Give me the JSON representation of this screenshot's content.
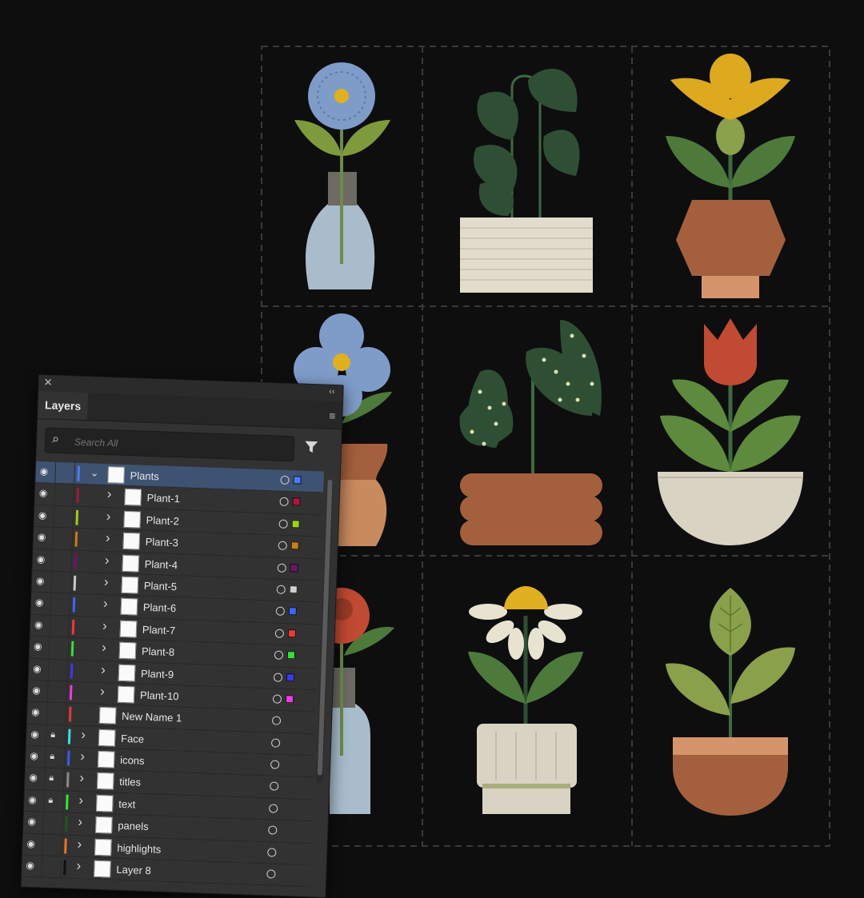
{
  "panel": {
    "tab_label": "Layers",
    "search_placeholder": "Search All",
    "close_icon": "close-icon",
    "collapse_icon": "double-chevron-left-icon",
    "menu_icon": "panel-menu-icon",
    "filter_icon": "filter-icon"
  },
  "layers": [
    {
      "name": "Plants",
      "color": "#4a7ef0",
      "visible": true,
      "locked": false,
      "expanded": true,
      "selected": true,
      "indent": 0,
      "swatch": "#4a7ef0"
    },
    {
      "name": "Plant-1",
      "color": "#9b1b3c",
      "visible": true,
      "locked": false,
      "expanded": false,
      "indent": 1,
      "swatch": "#b0163b"
    },
    {
      "name": "Plant-2",
      "color": "#9ccc1a",
      "visible": true,
      "locked": false,
      "expanded": false,
      "indent": 1,
      "swatch": "#9bd21c"
    },
    {
      "name": "Plant-3",
      "color": "#c77a1b",
      "visible": true,
      "locked": false,
      "expanded": false,
      "indent": 1,
      "swatch": "#c5801f"
    },
    {
      "name": "Plant-4",
      "color": "#6c1466",
      "visible": true,
      "locked": false,
      "expanded": false,
      "indent": 1,
      "swatch": "#6d1668"
    },
    {
      "name": "Plant-5",
      "color": "#c8c8c8",
      "visible": true,
      "locked": false,
      "expanded": false,
      "indent": 1,
      "swatch": "#cfcfcf"
    },
    {
      "name": "Plant-6",
      "color": "#3d67f0",
      "visible": true,
      "locked": false,
      "expanded": false,
      "indent": 1,
      "swatch": "#3a66f2"
    },
    {
      "name": "Plant-7",
      "color": "#e83b3b",
      "visible": true,
      "locked": false,
      "expanded": false,
      "indent": 1,
      "swatch": "#ea3a3a"
    },
    {
      "name": "Plant-8",
      "color": "#3bdc3b",
      "visible": true,
      "locked": false,
      "expanded": false,
      "indent": 1,
      "swatch": "#38e03a"
    },
    {
      "name": "Plant-9",
      "color": "#3a3ae8",
      "visible": true,
      "locked": false,
      "expanded": false,
      "indent": 1,
      "swatch": "#3a3aee"
    },
    {
      "name": "Plant-10",
      "color": "#e83bd8",
      "visible": true,
      "locked": false,
      "expanded": false,
      "indent": 1,
      "swatch": "#ea3ee0"
    },
    {
      "name": "New Name 1",
      "color": "#e03a3a",
      "visible": true,
      "locked": false,
      "expanded": null,
      "indent": 0,
      "swatch": null
    },
    {
      "name": "Face",
      "color": "#3be0e0",
      "visible": true,
      "locked": true,
      "expanded": false,
      "indent": 0,
      "swatch": null
    },
    {
      "name": "icons",
      "color": "#3a5ae8",
      "visible": true,
      "locked": true,
      "expanded": false,
      "indent": 0,
      "swatch": null
    },
    {
      "name": "titles",
      "color": "#8a8a8a",
      "visible": true,
      "locked": true,
      "expanded": false,
      "indent": 0,
      "swatch": null
    },
    {
      "name": "text",
      "color": "#3be03b",
      "visible": true,
      "locked": true,
      "expanded": false,
      "indent": 0,
      "swatch": null
    },
    {
      "name": "panels",
      "color": "#1b5a1b",
      "visible": true,
      "locked": false,
      "expanded": false,
      "indent": 0,
      "swatch": null
    },
    {
      "name": "highlights",
      "color": "#e8741b",
      "visible": true,
      "locked": false,
      "expanded": false,
      "indent": 0,
      "swatch": null
    },
    {
      "name": "Layer 8",
      "color": "#111111",
      "visible": true,
      "locked": false,
      "expanded": false,
      "indent": 0,
      "swatch": null
    }
  ]
}
